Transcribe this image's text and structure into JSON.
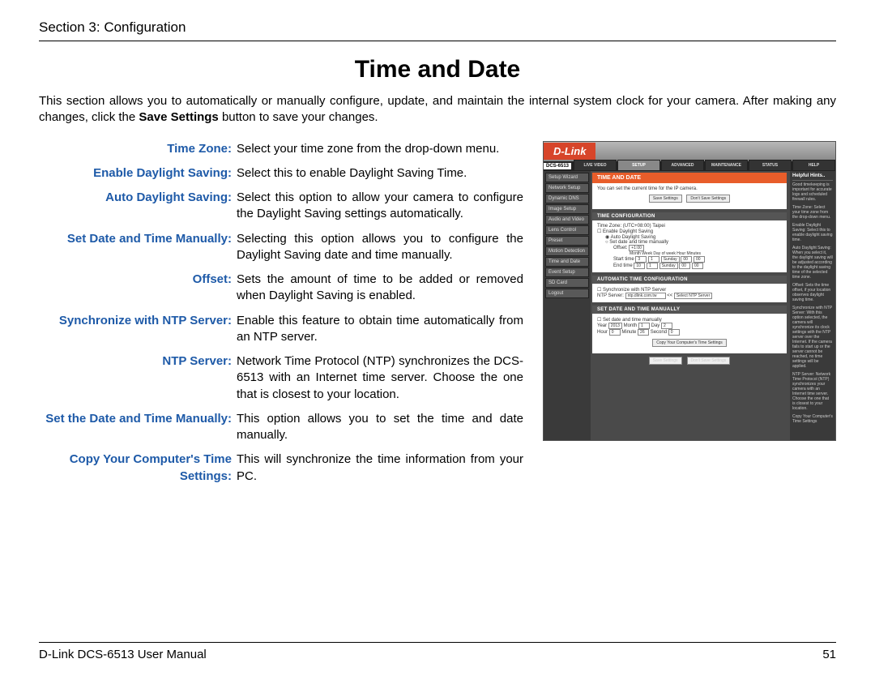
{
  "header": {
    "section": "Section 3: Configuration"
  },
  "title": "Time and Date",
  "intro_a": "This section allows you to automatically or manually configure, update, and maintain the internal system clock for your camera. After making any changes, click the ",
  "intro_bold": "Save Settings",
  "intro_b": " button to save your changes.",
  "defs": [
    {
      "label": "Time Zone",
      "desc": "Select your time zone from the drop-down menu."
    },
    {
      "label": "Enable Daylight Saving",
      "desc": "Select this to enable Daylight Saving Time."
    },
    {
      "label": "Auto Daylight Saving",
      "desc": "Select this option to allow your camera to configure the Daylight Saving settings automatically."
    },
    {
      "label": "Set Date and Time Manually",
      "desc": "Selecting this option allows you to configure the Daylight Saving date and time manually."
    },
    {
      "label": "Offset",
      "desc": "Sets the amount of time to be added or removed when Daylight Saving is enabled."
    },
    {
      "label": "Synchronize with NTP Server",
      "desc": "Enable this feature to obtain time automatically from an NTP server."
    },
    {
      "label": "NTP Server",
      "desc": "Network Time Protocol (NTP) synchronizes the DCS-6513 with an Internet time server. Choose the one that is closest to your location."
    },
    {
      "label": "Set the Date and Time Manually",
      "desc": "This option allows you to set the time and date manually."
    },
    {
      "label": "Copy Your Computer's Time Settings",
      "desc": "This will synchronize the time information from your PC."
    }
  ],
  "shot": {
    "logo": "D-Link",
    "model": "DCS-6513",
    "tabs": [
      "LIVE VIDEO",
      "SETUP",
      "ADVANCED",
      "MAINTENANCE",
      "STATUS",
      "HELP"
    ],
    "active_tab": 1,
    "sidebar": [
      "Setup Wizard",
      "Network Setup",
      "Dynamic DNS",
      "Image Setup",
      "Audio and Video",
      "Lens Control",
      "Preset",
      "Motion Detection",
      "Time and Date",
      "Event Setup",
      "SD Card",
      "Logout"
    ],
    "panel_title": "TIME AND DATE",
    "panel_sub": "You can set the current time for the IP camera.",
    "save": "Save Settings",
    "dont_save": "Don't Save Settings",
    "sec1": "TIME CONFIGURATION",
    "tz_label": "Time Zone:",
    "tz_value": "(UTC+08:00) Taipei",
    "eds": "Enable Daylight Saving",
    "ads": "Auto Daylight Saving",
    "sdtm": "Set date and time manually",
    "offset": "Offset:",
    "offset_v": "+1:00",
    "cols": "Month   Week  Day of week  Hour   Minutes",
    "start": "Start time",
    "end": "End time",
    "sec2": "AUTOMATIC TIME CONFIGURATION",
    "sync": "Synchronize with NTP Server",
    "ntp_label": "NTP Server:",
    "ntp_val": "ntp.dlink.com.tw",
    "ntp_btn": "Select NTP Server",
    "sec3": "SET DATE AND TIME MANUALLY",
    "sdt": "Set date and time manually",
    "year": "Year",
    "month": "Month",
    "day": "Day",
    "hour": "Hour",
    "minute": "Minute",
    "second": "Second",
    "yv": "2013",
    "mv": "1",
    "dv": "2",
    "hv": "0",
    "miv": "26",
    "sv": "0",
    "copy_btn": "Copy Your Computer's Time Settings",
    "hints_hdr": "Helpful Hints..",
    "hints": [
      "Good timekeeping is important for accurate logs and scheduled firewall rules.",
      "Time Zone: Select your time zone from the drop-down menu.",
      "Enable Daylight Saving: Select this to enable daylight saving time.",
      "Auto Daylight Saving: When you select it, the daylight saving will be adjusted according to the daylight saving time of the selected time zone.",
      "Offset: Sets the time offset, if your location observes daylight saving time.",
      "Synchronize with NTP Server: With this option selected, the camera will synchronize its clock settings with the NTP server over the Internet. If the camera fails to start up or the server cannot be reached, no time settings will be applied.",
      "NTP Server: Network Time Protocol (NTP) synchronizes your camera with an Internet time server. Choose the one that is closest to your location.",
      "Copy Your Computer's Time Settings"
    ]
  },
  "footer": {
    "left": "D-Link DCS-6513 User Manual",
    "right": "51"
  }
}
